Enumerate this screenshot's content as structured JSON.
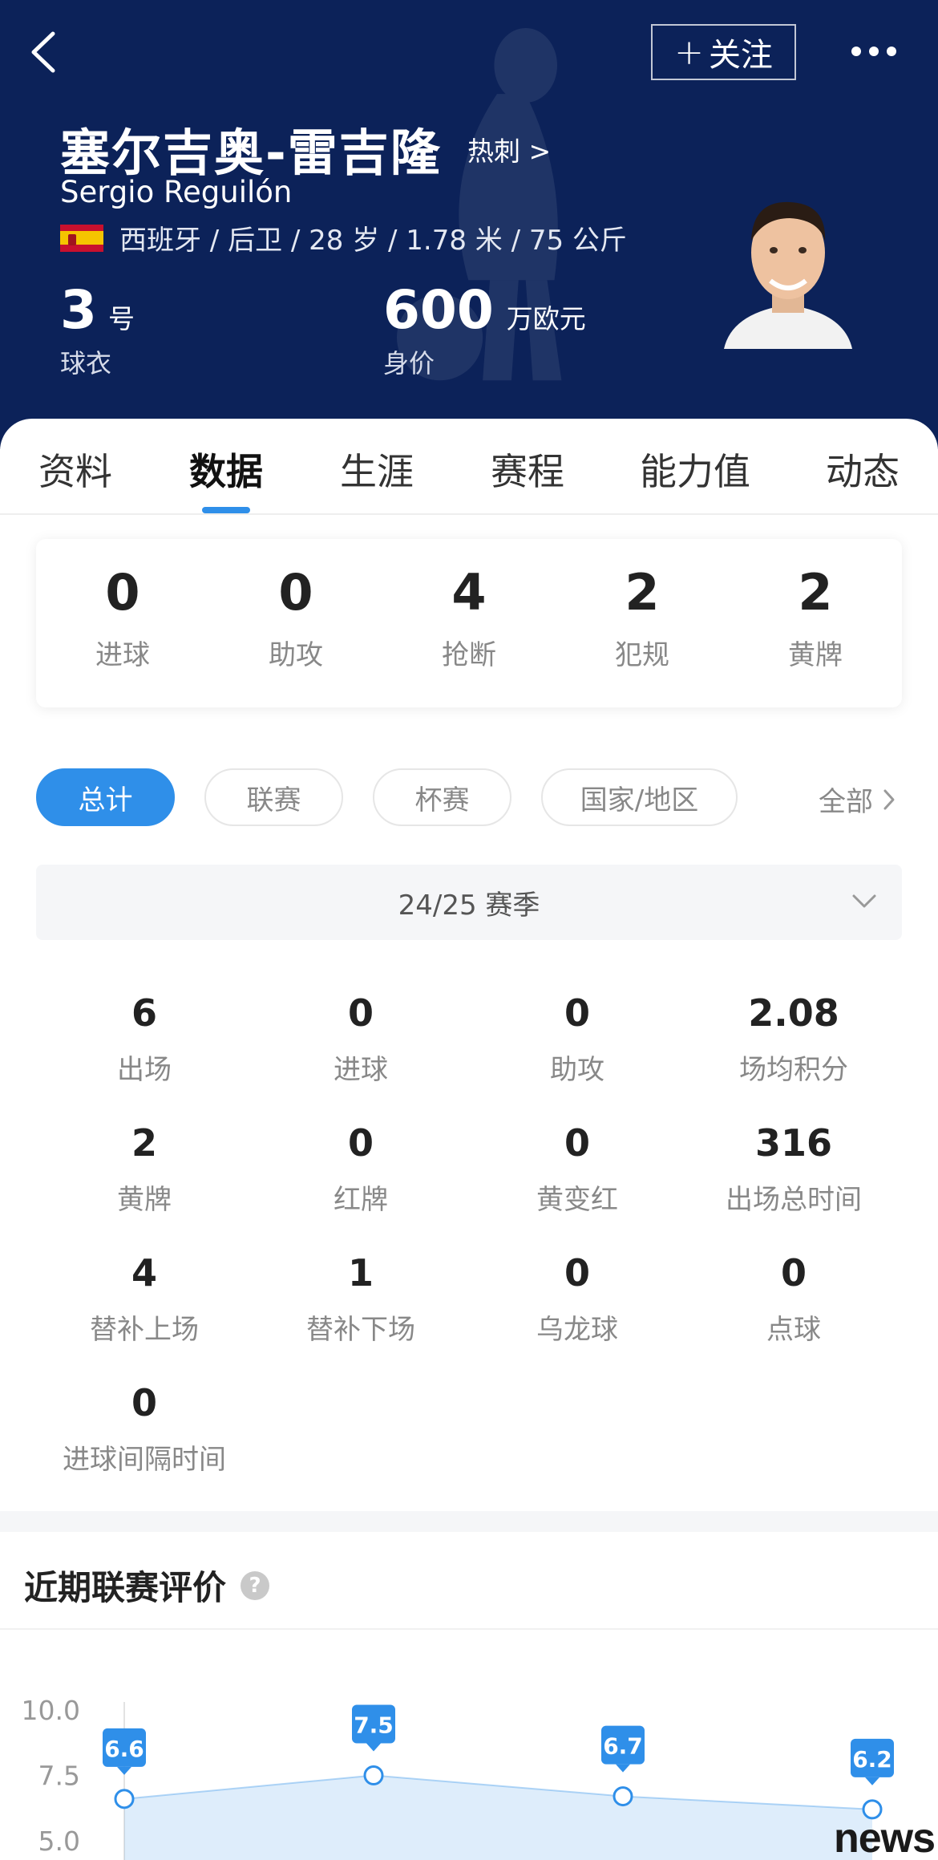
{
  "header": {
    "follow_label": "关注",
    "follow_plus": "+",
    "name_cn": "塞尔吉奥-雷吉隆",
    "team_link": "热刺 >",
    "name_en": "Sergio Reguilón",
    "info": "西班牙 / 后卫 / 28 岁 / 1.78 米 / 75 公斤",
    "flag": "spain-flag-icon",
    "shirt_number": "3",
    "shirt_unit": "号",
    "shirt_label": "球衣",
    "market_value": "600",
    "market_unit": "万欧元",
    "market_label": "身价"
  },
  "tabs": [
    {
      "label": "资料"
    },
    {
      "label": "数据"
    },
    {
      "label": "生涯"
    },
    {
      "label": "赛程"
    },
    {
      "label": "能力值"
    },
    {
      "label": "动态"
    }
  ],
  "active_tab": "数据",
  "summary": [
    {
      "value": "0",
      "label": "进球"
    },
    {
      "value": "0",
      "label": "助攻"
    },
    {
      "value": "4",
      "label": "抢断"
    },
    {
      "value": "2",
      "label": "犯规"
    },
    {
      "value": "2",
      "label": "黄牌"
    }
  ],
  "filters": [
    {
      "label": "总计",
      "active": true
    },
    {
      "label": "联赛",
      "active": false
    },
    {
      "label": "杯赛",
      "active": false
    },
    {
      "label": "国家/地区",
      "active": false
    }
  ],
  "filter_all": "全部",
  "season": "24/25 赛季",
  "stats": [
    {
      "value": "6",
      "label": "出场"
    },
    {
      "value": "0",
      "label": "进球"
    },
    {
      "value": "0",
      "label": "助攻"
    },
    {
      "value": "2.08",
      "label": "场均积分"
    },
    {
      "value": "2",
      "label": "黄牌"
    },
    {
      "value": "0",
      "label": "红牌"
    },
    {
      "value": "0",
      "label": "黄变红"
    },
    {
      "value": "316",
      "label": "出场总时间"
    },
    {
      "value": "4",
      "label": "替补上场"
    },
    {
      "value": "1",
      "label": "替补下场"
    },
    {
      "value": "0",
      "label": "乌龙球"
    },
    {
      "value": "0",
      "label": "点球"
    },
    {
      "value": "0",
      "label": "进球间隔时间"
    }
  ],
  "rating_section": {
    "title": "近期联赛评价",
    "help": "?"
  },
  "chart_data": {
    "type": "area",
    "y_ticks": [
      "10.0",
      "7.5",
      "5.0"
    ],
    "ylim": [
      5.0,
      10.0
    ],
    "values": [
      6.6,
      7.5,
      6.7,
      6.2
    ],
    "labels": [
      "6.6",
      "7.5",
      "6.7",
      "6.2"
    ],
    "color": "#2f8fe9"
  },
  "watermark": "news"
}
